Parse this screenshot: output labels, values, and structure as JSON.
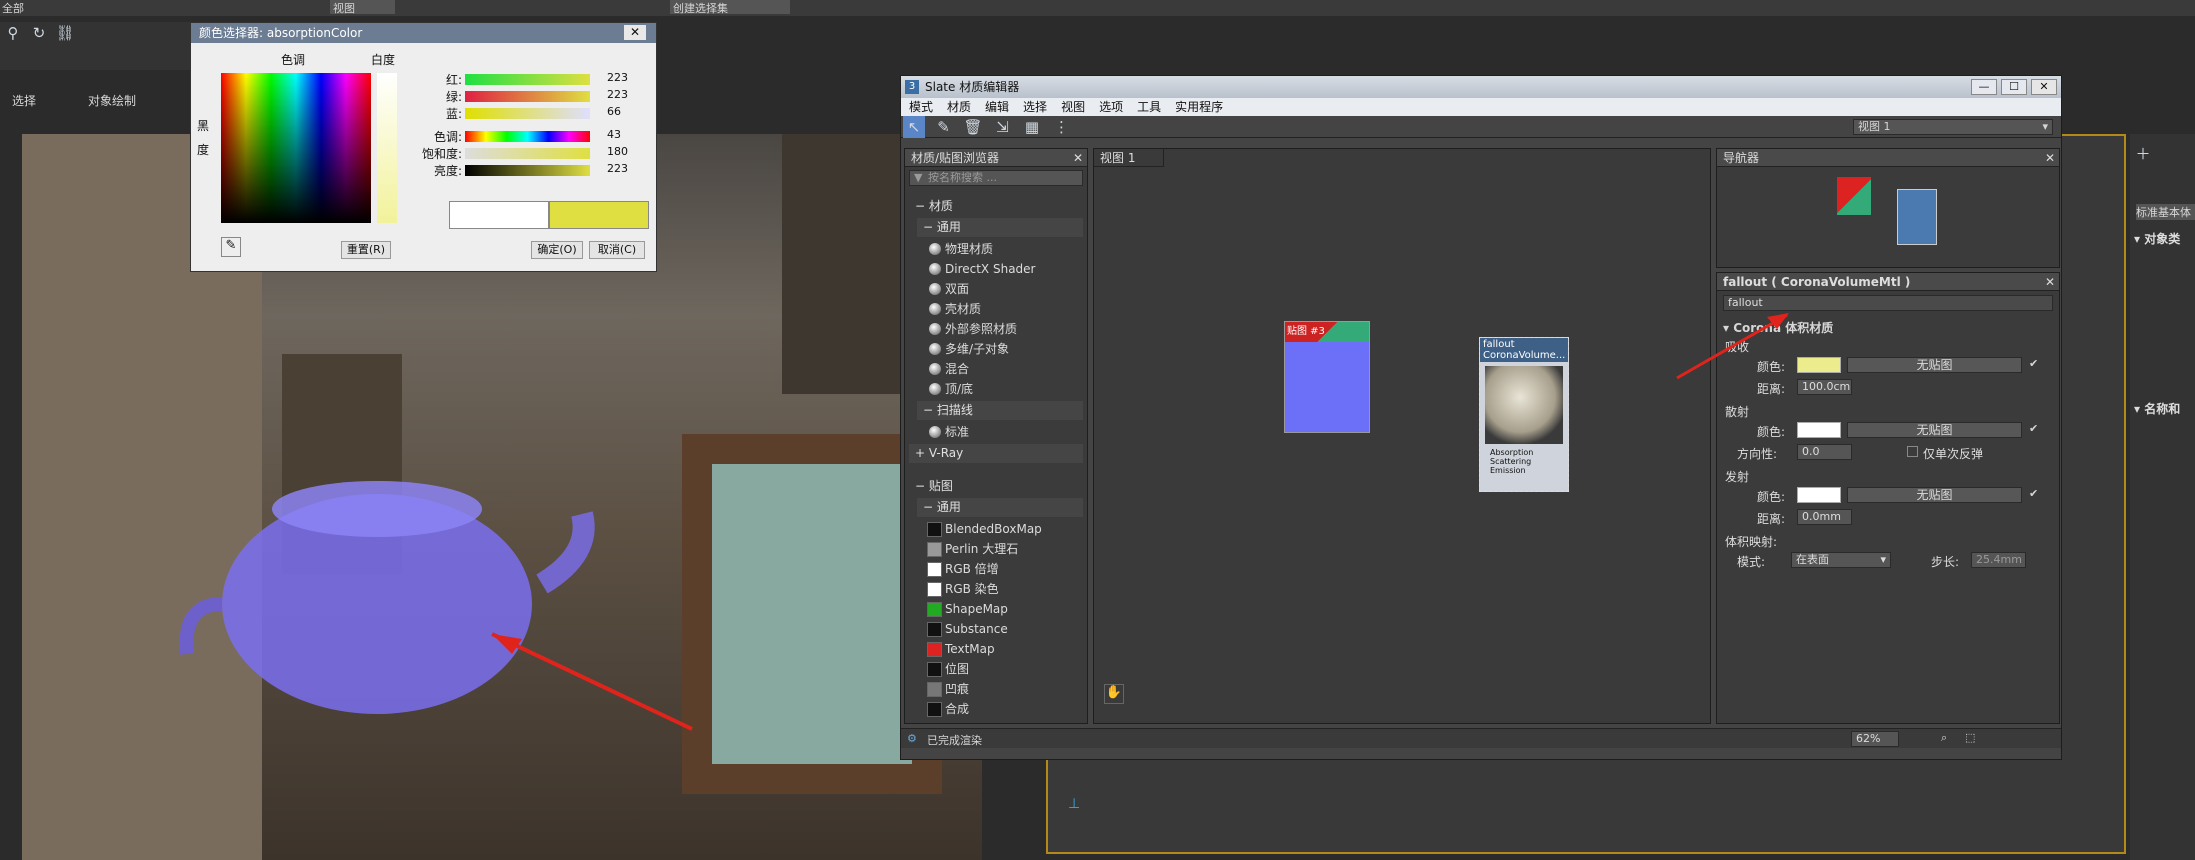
{
  "main_toolbar": {
    "partial_label": "全部",
    "view_dropdown": "视图",
    "selection_set": "创建选择集"
  },
  "ribbon": {
    "labels": [
      "选择",
      "对象绘制"
    ]
  },
  "color_picker": {
    "title": "颜色选择器: absorptionColor",
    "hue_label": "色调",
    "white_label": "白度",
    "black_label": "黑",
    "degree_label": "度",
    "sliders": [
      {
        "label": "红:",
        "value": "223"
      },
      {
        "label": "绿:",
        "value": "223"
      },
      {
        "label": "蓝:",
        "value": "66"
      },
      {
        "label": "色调:",
        "value": "43"
      },
      {
        "label": "饱和度:",
        "value": "180"
      },
      {
        "label": "亮度:",
        "value": "223"
      }
    ],
    "reset": "重置(R)",
    "ok": "确定(O)",
    "cancel": "取消(C)",
    "new_color": "#dfdf42",
    "old_color": "#ffffff"
  },
  "slate": {
    "title": "Slate 材质编辑器",
    "title_icon": "3",
    "menu": [
      "模式",
      "材质",
      "编辑",
      "选择",
      "视图",
      "选项",
      "工具",
      "实用程序"
    ],
    "view_dropdown": "视图 1",
    "browser": {
      "header": "材质/贴图浏览器",
      "search": "按名称搜索 ...",
      "mat_group": "材质",
      "mat_sub": "通用",
      "materials": [
        "物理材质",
        "DirectX Shader",
        "双面",
        "壳材质",
        "外部参照材质",
        "多维/子对象",
        "混合",
        "顶/底"
      ],
      "scan_group": "扫描线",
      "scan_items": [
        "标准"
      ],
      "vray": "+ V-Ray",
      "map_group": "贴图",
      "map_sub": "通用",
      "maps": [
        "BlendedBoxMap",
        "Perlin 大理石",
        "RGB 倍增",
        "RGB 染色",
        "ShapeMap",
        "Substance",
        "TextMap",
        "位图",
        "凹痕",
        "合成"
      ]
    },
    "view_tab": "视图 1",
    "node_a": {
      "title": "贴图 #3"
    },
    "node_b": {
      "title1": "fallout",
      "title2": "CoronaVolume...",
      "slots": [
        "Absorption",
        "Scattering",
        "Emission"
      ]
    },
    "navigator": "导航器",
    "params": {
      "header": "fallout ( CoronaVolumeMtl )",
      "name": "fallout",
      "rollout": "Corona 体积材质",
      "absorb": "吸收",
      "color": "颜色:",
      "distance": "距离:",
      "dist_value": "100.0cm",
      "nomap": "无贴图",
      "scatter": "散射",
      "direction": "方向性:",
      "dir_value": "0.0",
      "single_bounce": "仅单次反弹",
      "emission": "发射",
      "emit_dist": "0.0mm",
      "vol_map": "体积映射:",
      "mode": "模式:",
      "mode_value": "在表面",
      "step": "步长:",
      "step_value": "25.4mm",
      "absorb_color": "#ecec8c"
    },
    "status": "已完成渲染",
    "zoom": "62%"
  },
  "right_cmd": {
    "std": "标准基本体",
    "obj_type": "对象类",
    "name_color": "名称和"
  }
}
